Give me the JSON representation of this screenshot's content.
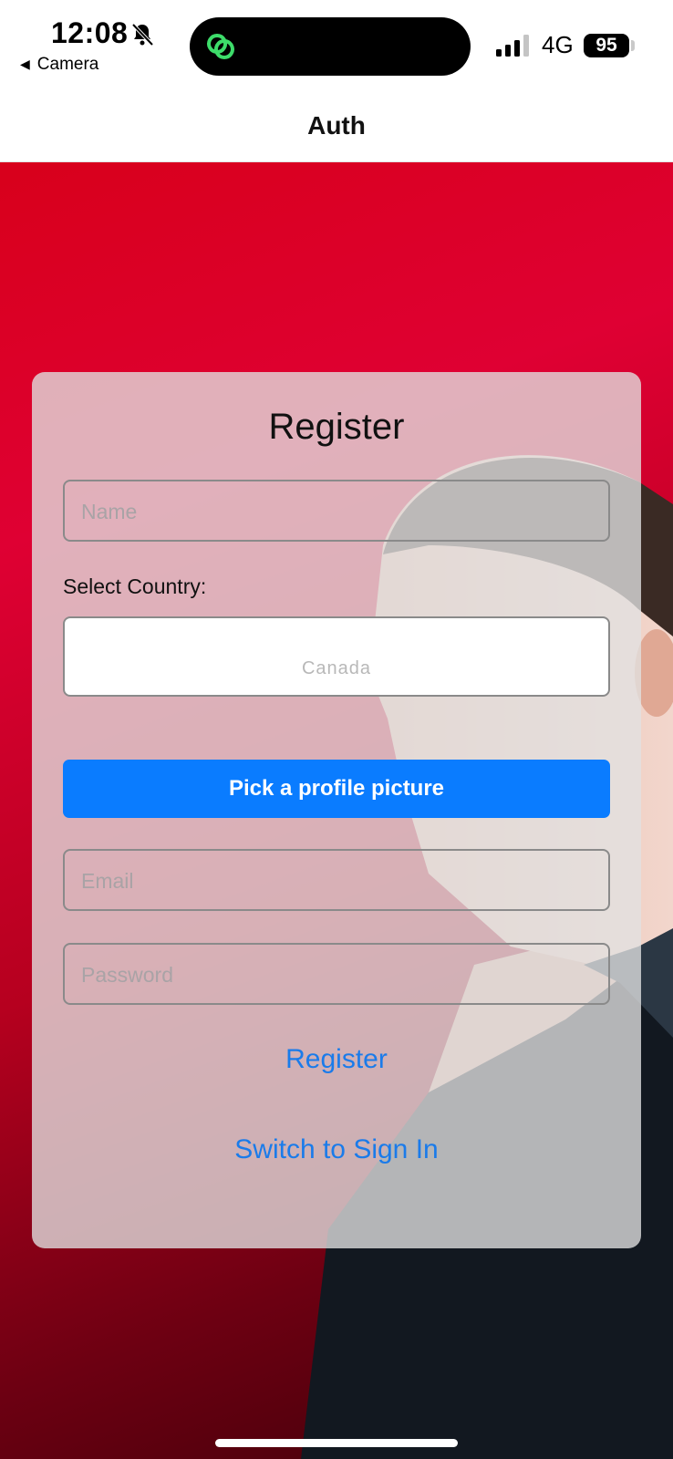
{
  "status_bar": {
    "time": "12:08",
    "back_app": "Camera",
    "network": "4G",
    "battery": "95",
    "icons": [
      "bell-slash-icon",
      "app-link-icon",
      "signal-icon"
    ]
  },
  "nav": {
    "title": "Auth"
  },
  "form": {
    "title": "Register",
    "name_placeholder": "Name",
    "country_label": "Select Country:",
    "country_value": "Canada",
    "pick_picture_label": "Pick a profile picture",
    "email_placeholder": "Email",
    "password_placeholder": "Password",
    "register_label": "Register",
    "switch_label": "Switch to Sign In"
  },
  "colors": {
    "accent": "#0a7cff",
    "link": "#1a7bea",
    "background_red": "#d8001b",
    "card": "#e1e1e1"
  }
}
